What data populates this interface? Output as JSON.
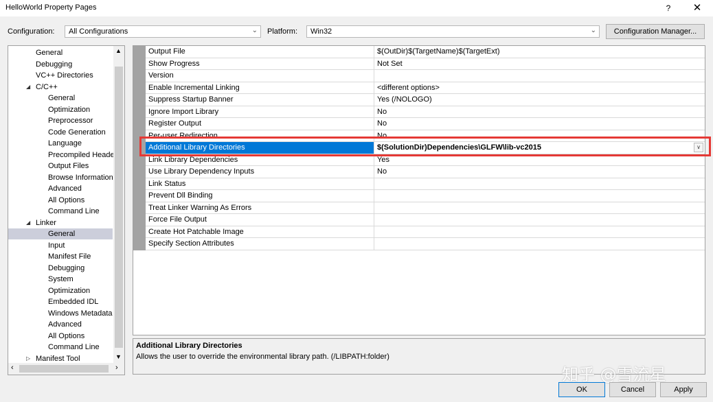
{
  "window": {
    "title": "HelloWorld Property Pages",
    "help": "?",
    "close": "✕"
  },
  "config": {
    "configuration_label": "Configuration:",
    "configuration_value": "All Configurations",
    "platform_label": "Platform:",
    "platform_value": "Win32",
    "manager_button": "Configuration Manager..."
  },
  "tree": {
    "items": [
      {
        "label": "General",
        "level": 1
      },
      {
        "label": "Debugging",
        "level": 1
      },
      {
        "label": "VC++ Directories",
        "level": 1
      },
      {
        "label": "C/C++",
        "level": 1,
        "expanded": true
      },
      {
        "label": "General",
        "level": 2
      },
      {
        "label": "Optimization",
        "level": 2
      },
      {
        "label": "Preprocessor",
        "level": 2
      },
      {
        "label": "Code Generation",
        "level": 2
      },
      {
        "label": "Language",
        "level": 2
      },
      {
        "label": "Precompiled Heade",
        "level": 2
      },
      {
        "label": "Output Files",
        "level": 2
      },
      {
        "label": "Browse Information",
        "level": 2
      },
      {
        "label": "Advanced",
        "level": 2
      },
      {
        "label": "All Options",
        "level": 2
      },
      {
        "label": "Command Line",
        "level": 2
      },
      {
        "label": "Linker",
        "level": 1,
        "expanded": true
      },
      {
        "label": "General",
        "level": 2,
        "selected": true
      },
      {
        "label": "Input",
        "level": 2
      },
      {
        "label": "Manifest File",
        "level": 2
      },
      {
        "label": "Debugging",
        "level": 2
      },
      {
        "label": "System",
        "level": 2
      },
      {
        "label": "Optimization",
        "level": 2
      },
      {
        "label": "Embedded IDL",
        "level": 2
      },
      {
        "label": "Windows Metadata",
        "level": 2
      },
      {
        "label": "Advanced",
        "level": 2
      },
      {
        "label": "All Options",
        "level": 2
      },
      {
        "label": "Command Line",
        "level": 2
      },
      {
        "label": "Manifest Tool",
        "level": 1,
        "collapsed": true
      }
    ]
  },
  "properties": [
    {
      "name": "Output File",
      "value": "$(OutDir)$(TargetName)$(TargetExt)"
    },
    {
      "name": "Show Progress",
      "value": "Not Set"
    },
    {
      "name": "Version",
      "value": ""
    },
    {
      "name": "Enable Incremental Linking",
      "value": "<different options>"
    },
    {
      "name": "Suppress Startup Banner",
      "value": "Yes (/NOLOGO)"
    },
    {
      "name": "Ignore Import Library",
      "value": "No"
    },
    {
      "name": "Register Output",
      "value": "No"
    },
    {
      "name": "Per-user Redirection",
      "value": "No"
    },
    {
      "name": "Additional Library Directories",
      "value": "$(SolutionDir)Dependencies\\GLFW\\lib-vc2015",
      "selected": true
    },
    {
      "name": "Link Library Dependencies",
      "value": "Yes"
    },
    {
      "name": "Use Library Dependency Inputs",
      "value": "No"
    },
    {
      "name": "Link Status",
      "value": ""
    },
    {
      "name": "Prevent Dll Binding",
      "value": ""
    },
    {
      "name": "Treat Linker Warning As Errors",
      "value": ""
    },
    {
      "name": "Force File Output",
      "value": ""
    },
    {
      "name": "Create Hot Patchable Image",
      "value": ""
    },
    {
      "name": "Specify Section Attributes",
      "value": ""
    }
  ],
  "description": {
    "title": "Additional Library Directories",
    "text": "Allows the user to override the environmental library path. (/LIBPATH:folder)"
  },
  "buttons": {
    "ok": "OK",
    "cancel": "Cancel",
    "apply": "Apply"
  },
  "watermark": "知乎 @雪流星",
  "colors": {
    "selection": "#0078d7",
    "highlight_box": "#e53935"
  }
}
